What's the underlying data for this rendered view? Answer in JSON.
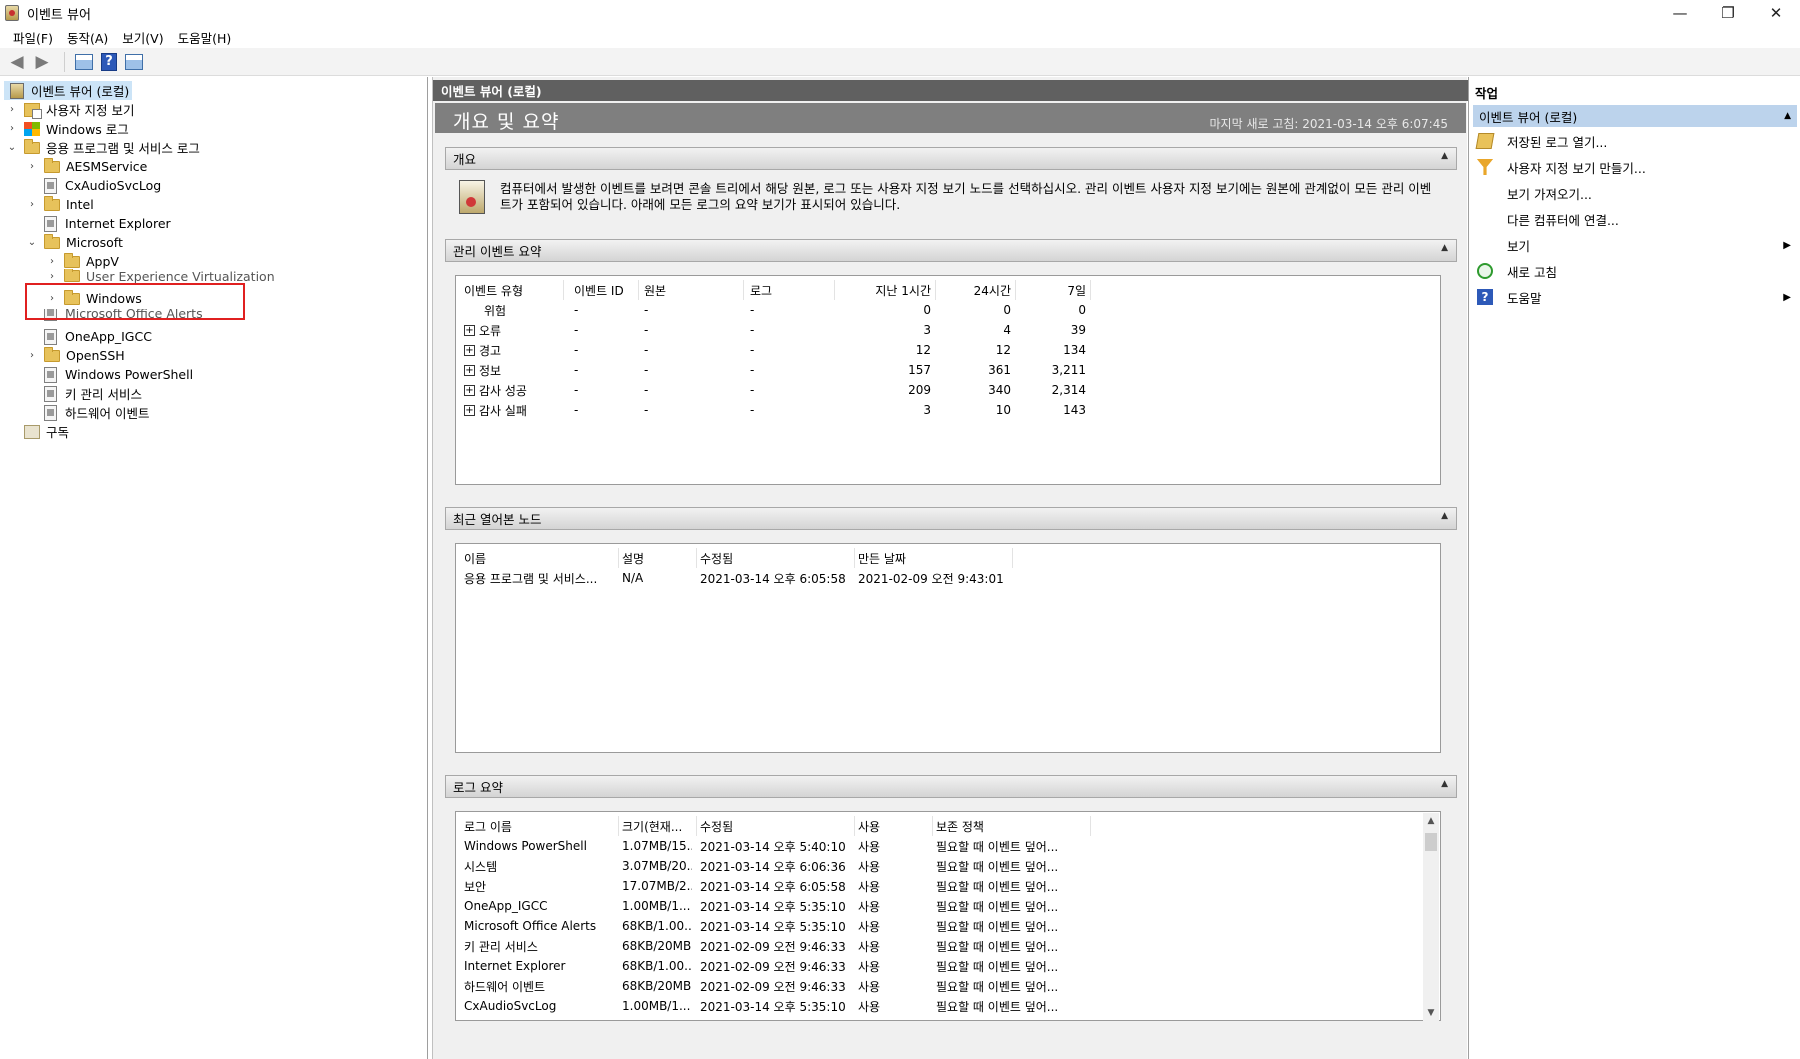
{
  "window": {
    "title": "이벤트 뷰어",
    "minimize": "—",
    "restore": "❐",
    "close": "✕"
  },
  "menu": [
    "파일(F)",
    "동작(A)",
    "보기(V)",
    "도움말(H)"
  ],
  "toolbar": {
    "back": "◀",
    "forward": "▶",
    "help": "?"
  },
  "tree": {
    "root": "이벤트 뷰어 (로컬)",
    "custom_views": "사용자 지정 보기",
    "windows_logs": "Windows 로그",
    "app_service_logs": "응용 프로그램 및 서비스 로그",
    "aesm": "AESMService",
    "cxaudio": "CxAudioSvcLog",
    "intel": "Intel",
    "ie": "Internet Explorer",
    "microsoft": "Microsoft",
    "appv": "AppV",
    "uev": "User Experience Virtualization",
    "windows": "Windows",
    "office_alerts": "Microsoft Office Alerts",
    "oneapp": "OneApp_IGCC",
    "openssh": "OpenSSH",
    "powershell": "Windows PowerShell",
    "key_mgmt": "키 관리 서비스",
    "hardware": "하드웨어 이벤트",
    "subscriptions": "구독"
  },
  "center": {
    "header": "이벤트 뷰어 (로컬)",
    "subtitle": "개요 및 요약",
    "last_refresh": "마지막 새로 고침: 2021-03-14 오후 6:07:45",
    "overview": {
      "title": "개요",
      "text": "컴퓨터에서 발생한 이벤트를 보려면 콘솔 트리에서 해당 원본, 로그 또는 사용자 지정 보기 노드를 선택하십시오. 관리 이벤트 사용자 지정 보기에는 원본에 관계없이 모든 관리 이벤트가 포함되어 있습니다. 아래에 모든 로그의 요약 보기가 표시되어 있습니다."
    },
    "admin_summary": {
      "title": "관리 이벤트 요약",
      "columns": [
        "이벤트 유형",
        "이벤트 ID",
        "원본",
        "로그",
        "지난 1시간",
        "24시간",
        "7일"
      ],
      "rows": [
        {
          "type": "위험",
          "id": "-",
          "source": "-",
          "log": "-",
          "h1": "0",
          "h24": "0",
          "d7": "0",
          "expand": ""
        },
        {
          "type": "오류",
          "id": "-",
          "source": "-",
          "log": "-",
          "h1": "3",
          "h24": "4",
          "d7": "39",
          "expand": "+"
        },
        {
          "type": "경고",
          "id": "-",
          "source": "-",
          "log": "-",
          "h1": "12",
          "h24": "12",
          "d7": "134",
          "expand": "+"
        },
        {
          "type": "정보",
          "id": "-",
          "source": "-",
          "log": "-",
          "h1": "157",
          "h24": "361",
          "d7": "3,211",
          "expand": "+"
        },
        {
          "type": "감사 성공",
          "id": "-",
          "source": "-",
          "log": "-",
          "h1": "209",
          "h24": "340",
          "d7": "2,314",
          "expand": "+"
        },
        {
          "type": "감사 실패",
          "id": "-",
          "source": "-",
          "log": "-",
          "h1": "3",
          "h24": "10",
          "d7": "143",
          "expand": "+"
        }
      ]
    },
    "recent_nodes": {
      "title": "최근 열어본 노드",
      "columns": [
        "이름",
        "설명",
        "수정됨",
        "만든 날짜"
      ],
      "rows": [
        {
          "name": "응용 프로그램 및 서비스...",
          "desc": "N/A",
          "modified": "2021-03-14 오후 6:05:58",
          "created": "2021-02-09 오전 9:43:01"
        }
      ]
    },
    "log_summary": {
      "title": "로그 요약",
      "columns": [
        "로그 이름",
        "크기(현재...",
        "수정됨",
        "사용",
        "보존 정책"
      ],
      "rows": [
        {
          "name": "Windows PowerShell",
          "size": "1.07MB/15...",
          "modified": "2021-03-14 오후 5:40:10",
          "enabled": "사용",
          "policy": "필요할 때 이벤트 덮어..."
        },
        {
          "name": "시스템",
          "size": "3.07MB/20...",
          "modified": "2021-03-14 오후 6:06:36",
          "enabled": "사용",
          "policy": "필요할 때 이벤트 덮어..."
        },
        {
          "name": "보안",
          "size": "17.07MB/2...",
          "modified": "2021-03-14 오후 6:05:58",
          "enabled": "사용",
          "policy": "필요할 때 이벤트 덮어..."
        },
        {
          "name": "OneApp_IGCC",
          "size": "1.00MB/1...",
          "modified": "2021-03-14 오후 5:35:10",
          "enabled": "사용",
          "policy": "필요할 때 이벤트 덮어..."
        },
        {
          "name": "Microsoft Office Alerts",
          "size": "68KB/1.00...",
          "modified": "2021-03-14 오후 5:35:10",
          "enabled": "사용",
          "policy": "필요할 때 이벤트 덮어..."
        },
        {
          "name": "키 관리 서비스",
          "size": "68KB/20MB",
          "modified": "2021-02-09 오전 9:46:33",
          "enabled": "사용",
          "policy": "필요할 때 이벤트 덮어..."
        },
        {
          "name": "Internet Explorer",
          "size": "68KB/1.00...",
          "modified": "2021-02-09 오전 9:46:33",
          "enabled": "사용",
          "policy": "필요할 때 이벤트 덮어..."
        },
        {
          "name": "하드웨어 이벤트",
          "size": "68KB/20MB",
          "modified": "2021-02-09 오전 9:46:33",
          "enabled": "사용",
          "policy": "필요할 때 이벤트 덮어..."
        },
        {
          "name": "CxAudioSvcLog",
          "size": "1.00MB/1...",
          "modified": "2021-03-14 오후 5:35:10",
          "enabled": "사용",
          "policy": "필요할 때 이벤트 덮어..."
        }
      ]
    }
  },
  "actions": {
    "title": "작업",
    "group": "이벤트 뷰어 (로컬)",
    "items": [
      {
        "label": "저장된 로그 열기...",
        "icon": "open-folder-icon",
        "submenu": false
      },
      {
        "label": "사용자 지정 보기 만들기...",
        "icon": "filter-icon",
        "submenu": false
      },
      {
        "label": "보기 가져오기...",
        "icon": "",
        "submenu": false
      },
      {
        "label": "다른 컴퓨터에 연결...",
        "icon": "",
        "submenu": false
      },
      {
        "label": "보기",
        "icon": "",
        "submenu": true
      },
      {
        "label": "새로 고침",
        "icon": "refresh-icon",
        "submenu": false
      },
      {
        "label": "도움말",
        "icon": "help-icon",
        "submenu": true
      }
    ]
  }
}
